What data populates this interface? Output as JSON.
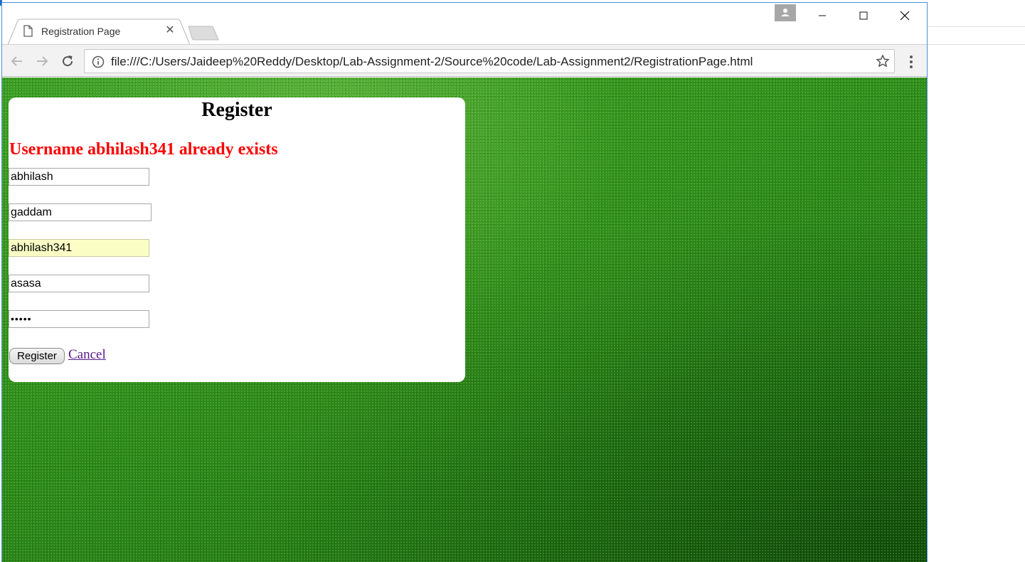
{
  "browser": {
    "tab_title": "Registration Page",
    "tab_close_glyph": "✕",
    "url": "file:///C:/Users/Jaideep%20Reddy/Desktop/Lab-Assignment-2/Source%20code/Lab-Assignment2/RegistrationPage.html"
  },
  "page": {
    "heading": "Register",
    "error_message": "Username abhilash341 already exists",
    "fields": {
      "first_name": "abhilash",
      "last_name": "gaddam",
      "username": "abhilash341",
      "email": "asasa",
      "password_mask": "•••••"
    },
    "register_label": "Register",
    "cancel_label": "Cancel"
  },
  "colors": {
    "error": "#ff0000",
    "link_visited": "#551a8b",
    "autofill_bg": "#fafec5",
    "background_green": "#2e8e1a"
  },
  "icons": [
    "page-icon",
    "close-icon",
    "new-tab-icon",
    "profile-icon",
    "minimize-icon",
    "maximize-icon",
    "window-close-icon",
    "back-arrow-icon",
    "forward-arrow-icon",
    "reload-icon",
    "info-icon",
    "star-icon",
    "menu-dots-icon"
  ]
}
